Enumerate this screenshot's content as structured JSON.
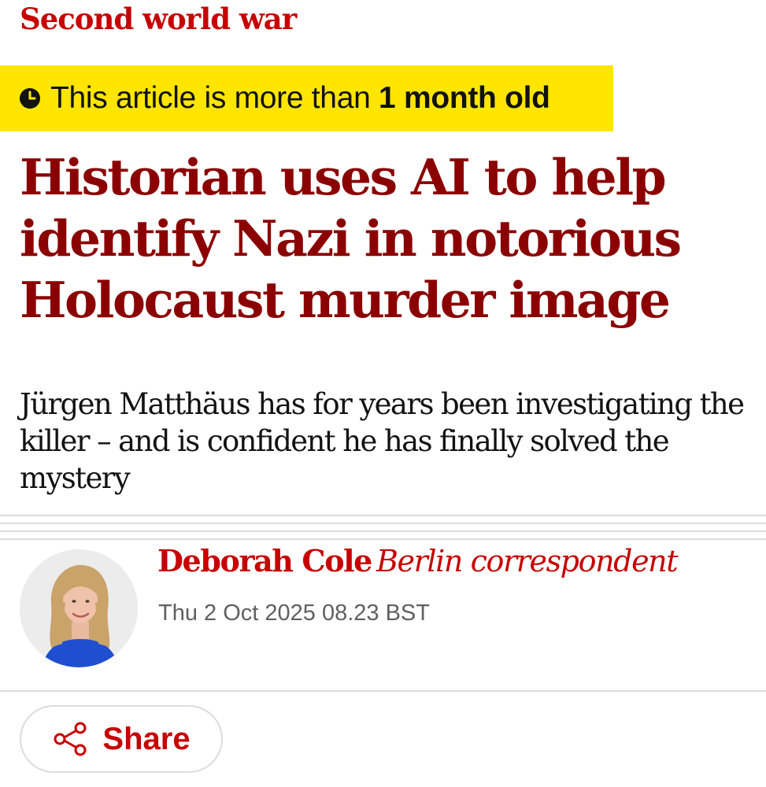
{
  "section": {
    "label": "Second world war"
  },
  "age_banner": {
    "icon": "clock-icon",
    "prefix": "This article is more than ",
    "emphasis": "1 month old",
    "background_color": "#ffe500"
  },
  "article": {
    "headline": "Historian uses AI to help identify Nazi in notorious Holocaust murder image",
    "standfirst": "Jürgen Matthäus has for years been investigating the killer – and is confident he has finally solved the mystery"
  },
  "byline": {
    "author_name": "Deborah Cole",
    "author_role": "Berlin correspondent",
    "date": "Thu 2 Oct 2025 08.23 BST",
    "avatar": "author-photo"
  },
  "share": {
    "label": "Share",
    "icon": "share-icon"
  },
  "colors": {
    "section_red": "#c70000",
    "headline_red": "#8b0000",
    "text": "#121212",
    "secondary_text": "#606060",
    "rule": "#dcdcdc"
  }
}
